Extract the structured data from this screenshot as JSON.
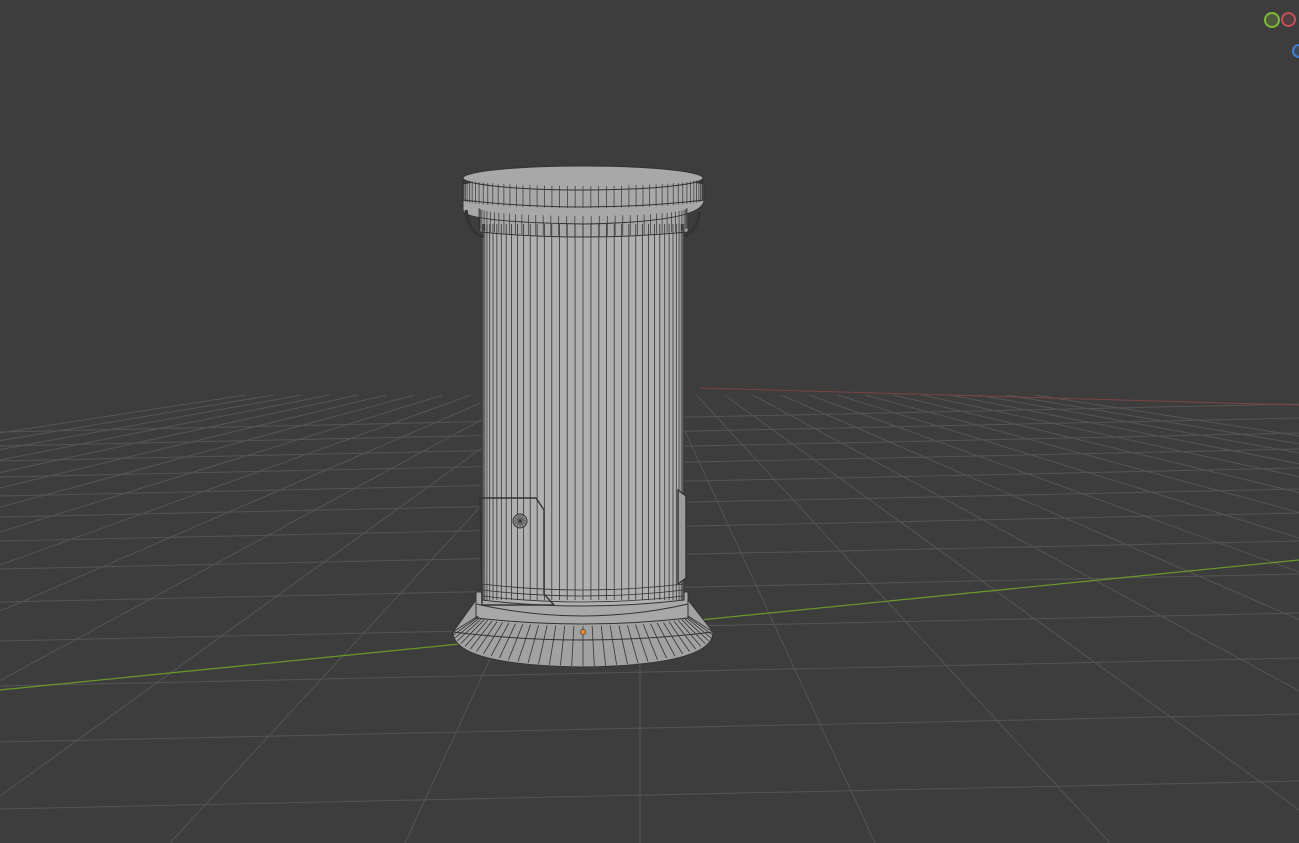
{
  "viewport": {
    "background_color": "#3d3d3d",
    "grid_color": "#555555",
    "y_axis_color": "#6a9a2e",
    "x_axis_color": "#7a4444"
  },
  "object": {
    "icon": "cylindrical-kiosk-wireframe-mesh",
    "surface_color": "#a8a8a8",
    "edge_color": "#333333",
    "origin_color": "#ff8a1f"
  },
  "gizmo": {
    "y_axis_color": "#7fb83a",
    "x_axis_color": "#c6505a",
    "z_axis_color": "#3e7ed8"
  }
}
